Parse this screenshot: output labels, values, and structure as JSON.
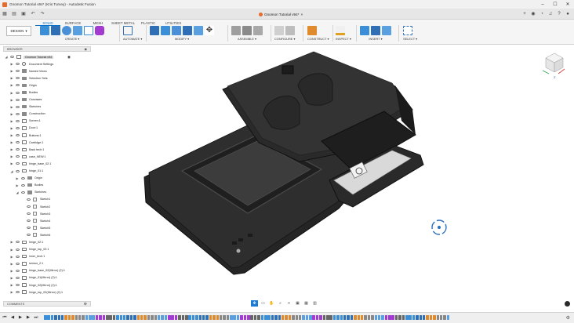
{
  "window": {
    "title": "Gnomon Tutorial v94* (Kris Turvey) - Autodesk Fusion",
    "controls": [
      "–",
      "☐",
      "✕"
    ]
  },
  "document_tab": {
    "title": "Gnomon Tutorial v94*"
  },
  "workspace_button": {
    "label": "DESIGN"
  },
  "ribbon": {
    "tabs": [
      "SOLID",
      "SURFACE",
      "MESH",
      "SHEET METAL",
      "PLASTIC",
      "UTILITIES"
    ],
    "active_tab": "SOLID",
    "groups": [
      {
        "label": "CREATE"
      },
      {
        "label": "AUTOMATE"
      },
      {
        "label": "MODIFY"
      },
      {
        "label": "ASSEMBLE"
      },
      {
        "label": "CONFIGURE"
      },
      {
        "label": "CONSTRUCT"
      },
      {
        "label": "INSPECT"
      },
      {
        "label": "INSERT"
      },
      {
        "label": "SELECT"
      }
    ]
  },
  "browser": {
    "header": "BROWSER",
    "rows": [
      {
        "label": "Gnomon Tutorial v94",
        "level": 0,
        "expanded": true,
        "root": true
      },
      {
        "label": "Document Settings",
        "level": 1,
        "icon": "gear"
      },
      {
        "label": "Named Views",
        "level": 1
      },
      {
        "label": "Selection Sets",
        "level": 1
      },
      {
        "label": "Origin",
        "level": 1
      },
      {
        "label": "Bodies",
        "level": 1
      },
      {
        "label": "Canvases",
        "level": 1
      },
      {
        "label": "Sketches",
        "level": 1
      },
      {
        "label": "Construction",
        "level": 1
      },
      {
        "label": "Screen:1",
        "level": 1,
        "component": true
      },
      {
        "label": "Door:1",
        "level": 1,
        "component": true
      },
      {
        "label": "Buttons:1",
        "level": 1,
        "component": true
      },
      {
        "label": "Cartridge:1",
        "level": 1,
        "component": true
      },
      {
        "label": "Back tech:1",
        "level": 1,
        "component": true
      },
      {
        "label": "case_NEW:1",
        "level": 1,
        "component": true
      },
      {
        "label": "hinge_base_02:1",
        "level": 1,
        "component": true
      },
      {
        "label": "hinge_01:1",
        "level": 1,
        "component": true,
        "expanded": true
      },
      {
        "label": "Origin",
        "level": 2
      },
      {
        "label": "Bodies",
        "level": 2
      },
      {
        "label": "Sketches",
        "level": 2,
        "expanded": true
      },
      {
        "label": "Sketch1",
        "level": 3,
        "sketch": true
      },
      {
        "label": "Sketch2",
        "level": 3,
        "sketch": true
      },
      {
        "label": "Sketch3",
        "level": 3,
        "sketch": true
      },
      {
        "label": "Sketch4",
        "level": 3,
        "sketch": true
      },
      {
        "label": "Sketch5",
        "level": 3,
        "sketch": true
      },
      {
        "label": "Sketch6",
        "level": 3,
        "sketch": true
      },
      {
        "label": "hinge_02:1",
        "level": 1,
        "component": true
      },
      {
        "label": "hinge_top_02:1",
        "level": 1,
        "component": true
      },
      {
        "label": "inner_tech:1",
        "level": 1,
        "component": true
      },
      {
        "label": "sensor_2:1",
        "level": 1,
        "component": true
      },
      {
        "label": "hinge_base_02(Mirror) (2):1",
        "level": 1,
        "component": true
      },
      {
        "label": "hinge_01(Mirror) (2):1",
        "level": 1,
        "component": true
      },
      {
        "label": "hinge_02(Mirror) (2):1",
        "level": 1,
        "component": true
      },
      {
        "label": "hinge_top_02(Mirror) (2):1",
        "level": 1,
        "component": true
      }
    ]
  },
  "comments": {
    "label": "COMMENTS"
  },
  "viewcube": {
    "face_label": "Z"
  },
  "colors": {
    "accent": "#0b6fc6",
    "device_body": "#2b2b2b",
    "device_edge": "#3e3e3e",
    "screen": "#3a3a3a",
    "cartridge": "#d9d9d9"
  }
}
